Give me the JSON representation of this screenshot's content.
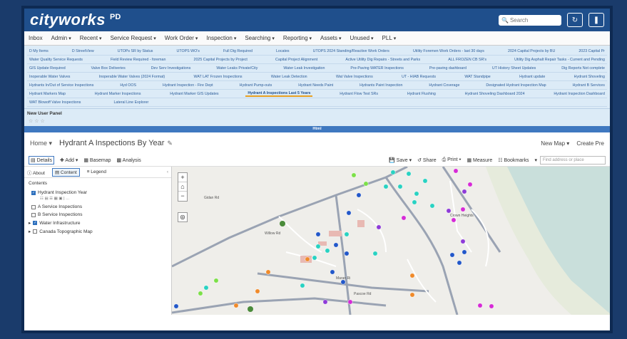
{
  "header": {
    "logo": "cityworks",
    "logo_suffix": "PD",
    "search_placeholder": "Search",
    "refresh_icon": "refresh-icon",
    "user_icon": "user-icon"
  },
  "menu": [
    {
      "label": "Inbox",
      "caret": false
    },
    {
      "label": "Admin",
      "caret": true
    },
    {
      "label": "Recent",
      "caret": true
    },
    {
      "label": "Service Request",
      "caret": true
    },
    {
      "label": "Work Order",
      "caret": true
    },
    {
      "label": "Inspection",
      "caret": true
    },
    {
      "label": "Searching",
      "caret": true
    },
    {
      "label": "Reporting",
      "caret": true
    },
    {
      "label": "Assets",
      "caret": true
    },
    {
      "label": "Unused",
      "caret": true
    },
    {
      "label": "PLL",
      "caret": true
    }
  ],
  "tiles": [
    [
      "D My Items",
      "D StreetView",
      "UTOPs SR by Status",
      "UTOPS WO's",
      "Full Dig Required",
      "Locates",
      "UTOPS 2024 Standing/Reactive Work Orders",
      "Utility Foremen Work Orders - last 30 days",
      "2024 Capital Projects by BU",
      "2023 Capital Pr"
    ],
    [
      "Water Quality Service Requests",
      "Field Review Required - foreman",
      "2025 Capital Projects by Project",
      "Capital Project Alignment",
      "Active Utility Dig Repairs - Streets and Parks",
      "ALL FROZEN CB SR's",
      "Utility Dig Asphalt Repair Tasks - Current and Pending"
    ],
    [
      "GIS Update Required",
      "Valve Box Deliveries",
      "Dev Serv Investigations",
      "Water Leaks Private/City",
      "Water Leak Investigation",
      "Pre-Paving WATER Inspections",
      "Pre-paving dashboard",
      "UT History Sheet Updates",
      "Dig Reports Not complete"
    ],
    [
      "Inoperable Water Valves",
      "Inoperable Water Valves (2024 Format)",
      "WAT LAT Frozen Inspections",
      "Water Leak Detection",
      "Wat Valve Inspections",
      "UT - HIAB Requests",
      "WAT Standpipe",
      "Hydrant update",
      "Hydrant Shoveling"
    ],
    [
      "Hydrants In/Out of Service Inspections",
      "Hyd OOS",
      "Hydrant Inspection - Fire Dept",
      "Hydrant Pump-outs",
      "Hydrant Needs Paint",
      "Hydrants Paint Inspection",
      "Hydrant Coverage",
      "Designated Hydrant Inspection Map",
      "Hydrant B Services"
    ],
    [
      "Hydrant Markers Map",
      "Hydrant Marker Inspections",
      "Hydrant Marker GIS Updates",
      "Hydrant A Inspections Last 5 Years",
      "Hydrant Flow Test SRs",
      "Hydrant Flushing",
      "Hydrant Shoveling Dashboard 2024",
      "Hydrant Inspection Dashboard"
    ],
    [
      "WAT Blowoff Valve Inspections",
      "Lateral Line Explorer"
    ]
  ],
  "active_tile": "Hydrant A Inspections Last 5 Years",
  "panel": {
    "title": "New User Panel",
    "stars": "☆ ☆ ☆",
    "strip": "Html"
  },
  "viewer": {
    "home": "Home",
    "title": "Hydrant A Inspections By Year",
    "new_map": "New Map",
    "create": "Create Pre",
    "toolbar_left": [
      "Details",
      "Add",
      "Basemap",
      "Analysis"
    ],
    "toolbar_right": [
      "Save",
      "Share",
      "Print",
      "Measure",
      "Bookmarks"
    ],
    "find_placeholder": "Find address or place",
    "tabs": [
      "About",
      "Content",
      "Legend"
    ],
    "contents_label": "Contents",
    "layers": [
      {
        "label": "Hydrant Inspection Year",
        "checked": true,
        "group": false
      },
      {
        "label": "A Service Inspections",
        "checked": false,
        "group": false
      },
      {
        "label": "B Service Inspections",
        "checked": false,
        "group": false
      },
      {
        "label": "Water Infrastructure",
        "checked": true,
        "group": true
      },
      {
        "label": "Canada Topographic Map",
        "checked": false,
        "group": true
      }
    ]
  },
  "map": {
    "labels": [
      "Crown Heights",
      "Gidan Rd",
      "Willow Rd",
      "Maran Ri",
      "Pascoe Rd"
    ],
    "colors": {
      "blue": "#2257c9",
      "cyan": "#28d2c2",
      "green": "#7ce048",
      "magenta": "#d62ad6",
      "orange": "#f08a2a",
      "purple": "#8e3bd8"
    }
  }
}
